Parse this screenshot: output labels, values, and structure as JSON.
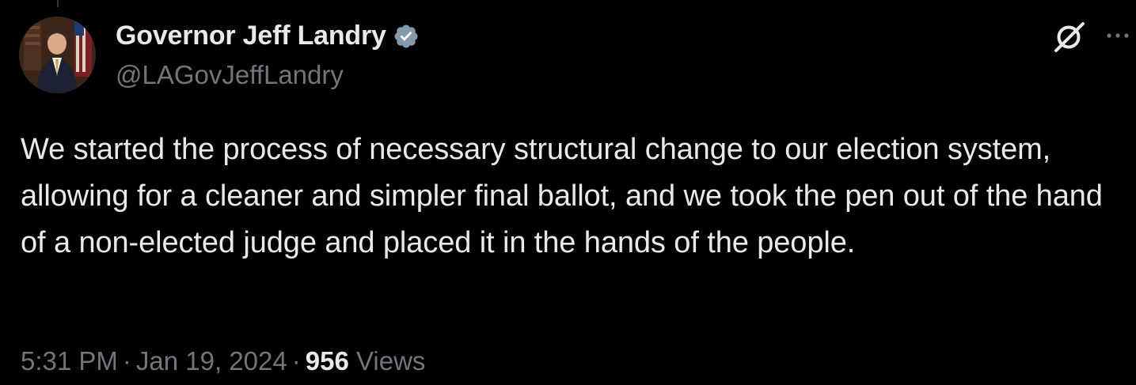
{
  "tweet": {
    "author": {
      "display_name": "Governor Jeff Landry",
      "handle": "@LAGovJeffLandry",
      "verified_icon": "verified-badge-icon",
      "verified_color": "#829aab"
    },
    "text": "We started the process of necessary structural change to our election system, allowing for a cleaner and simpler final ballot, and we took the pen out of the hand of a non-elected judge and placed it in the hands of the people.",
    "time": "5:31 PM",
    "separator": "·",
    "date": "Jan 19, 2024",
    "views_count": "956",
    "views_label": "Views"
  },
  "toolbar": {
    "grok_icon": "grok-icon",
    "more_icon": "more-dots-icon"
  },
  "colors": {
    "background": "#000000",
    "primary_text": "#e7e9ea",
    "secondary_text": "#71767b"
  }
}
